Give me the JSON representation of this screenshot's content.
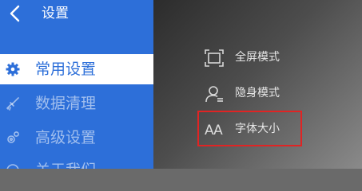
{
  "header": {
    "title": "设置"
  },
  "sidebar": {
    "items": [
      {
        "label": "常用设置",
        "icon": "gear-icon",
        "active": true
      },
      {
        "label": "数据清理",
        "icon": "broom-icon",
        "active": false
      },
      {
        "label": "高级设置",
        "icon": "gears-icon",
        "active": false
      },
      {
        "label": "关于我们",
        "icon": "info-icon",
        "active": false
      }
    ]
  },
  "main": {
    "options": [
      {
        "label": "全屏模式",
        "icon": "fullscreen-icon"
      },
      {
        "label": "隐身模式",
        "icon": "incognito-user-icon"
      },
      {
        "label": "字体大小",
        "icon": "font-size-icon",
        "glyph": "AA",
        "highlighted": true
      }
    ]
  },
  "colors": {
    "sidebar_bg": "#2d6fd9",
    "active_item_bg": "#ffffff",
    "highlight_border": "#e02424"
  }
}
